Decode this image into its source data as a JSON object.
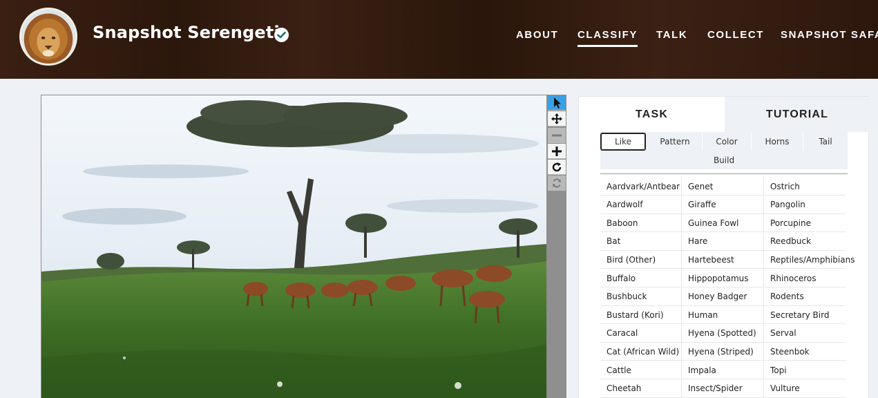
{
  "header": {
    "site_title": "Snapshot Serengeti",
    "verified_icon": "verified-check-icon",
    "avatar_icon": "lion-avatar",
    "nav": [
      {
        "label": "ABOUT",
        "active": false
      },
      {
        "label": "CLASSIFY",
        "active": true
      },
      {
        "label": "TALK",
        "active": false
      },
      {
        "label": "COLLECT",
        "active": false
      },
      {
        "label": "SNAPSHOT SAFARI",
        "active": false
      }
    ]
  },
  "viewer": {
    "tools": [
      {
        "name": "pointer-icon",
        "state": "active"
      },
      {
        "name": "pan-icon",
        "state": "enabled"
      },
      {
        "name": "zoom-out-icon",
        "state": "disabled"
      },
      {
        "name": "zoom-in-icon",
        "state": "enabled"
      },
      {
        "name": "rotate-icon",
        "state": "enabled"
      },
      {
        "name": "reset-icon",
        "state": "disabled"
      }
    ]
  },
  "panel": {
    "tabs": [
      "TASK",
      "TUTORIAL"
    ],
    "active_tab": "TASK",
    "filters": [
      "Like",
      "Pattern",
      "Color",
      "Horns",
      "Tail",
      "Build"
    ],
    "selected_filter": "Like",
    "species_columns": [
      [
        "Aardvark/Antbear",
        "Aardwolf",
        "Baboon",
        "Bat",
        "Bird (Other)",
        "Buffalo",
        "Bushbuck",
        "Bustard (Kori)",
        "Caracal",
        "Cat (African Wild)",
        "Cattle",
        "Cheetah"
      ],
      [
        "Genet",
        "Giraffe",
        "Guinea Fowl",
        "Hare",
        "Hartebeest",
        "Hippopotamus",
        "Honey Badger",
        "Human",
        "Hyena (Spotted)",
        "Hyena (Striped)",
        "Impala",
        "Insect/Spider"
      ],
      [
        "Ostrich",
        "Pangolin",
        "Porcupine",
        "Reedbuck",
        "Reptiles/Amphibians",
        "Rhinoceros",
        "Rodents",
        "Secretary Bird",
        "Serval",
        "Steenbok",
        "Topi",
        "Vulture"
      ]
    ]
  },
  "colors": {
    "header_bg": "#2e180d",
    "page_bg": "#eef1f5",
    "tool_active": "#3aa0e6"
  }
}
